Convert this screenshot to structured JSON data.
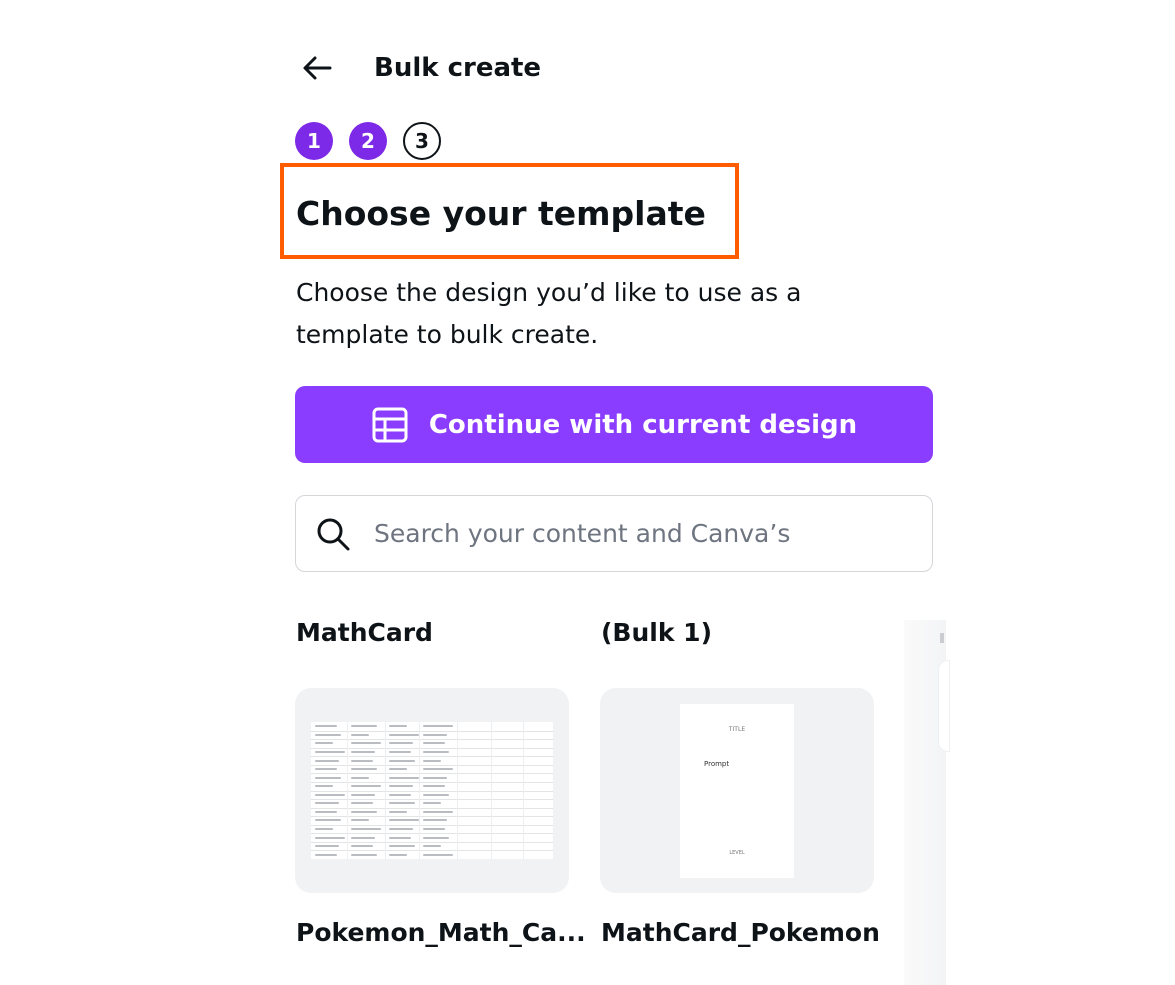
{
  "header": {
    "back_icon": "arrow-left-icon",
    "title": "Bulk create"
  },
  "steps": [
    {
      "label": "1",
      "state": "completed"
    },
    {
      "label": "2",
      "state": "completed"
    },
    {
      "label": "3",
      "state": "upcoming"
    }
  ],
  "section": {
    "title": "Choose your template",
    "description": "Choose the design you’d like to use as a template to bulk create."
  },
  "primary_button": {
    "icon": "grid-icon",
    "label": "Continue with current design"
  },
  "search": {
    "icon": "search-icon",
    "placeholder": "Search your content and Canva’s",
    "value": ""
  },
  "folders": [
    {
      "label": "MathCard"
    },
    {
      "label": "(Bulk 1)"
    }
  ],
  "cards": [
    {
      "name": "Pokemon_Math_Ca...",
      "thumb": "spreadsheet"
    },
    {
      "name": "MathCard_Pokemon",
      "thumb": "page",
      "page_text": {
        "title": "TITLE",
        "prompt": "Prompt",
        "footer": "LEVEL"
      }
    }
  ],
  "colors": {
    "accent": "#8b3dff",
    "step_active": "#7d2ae8",
    "highlight": "#ff5c00"
  }
}
